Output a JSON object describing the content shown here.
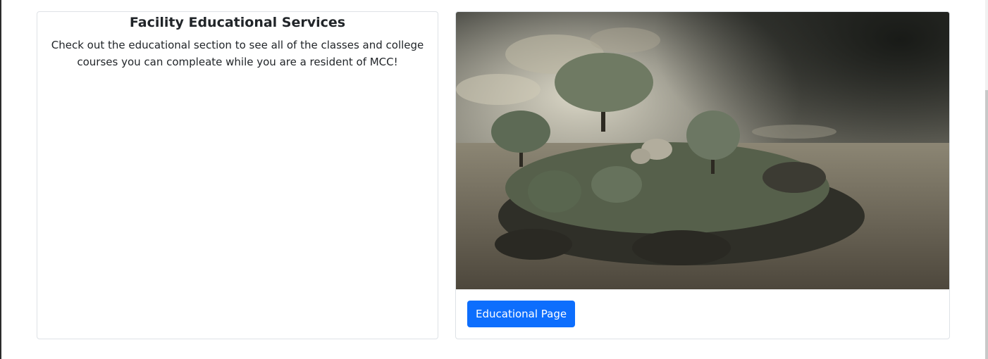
{
  "education_card": {
    "title": "Facility Educational Services",
    "text": "Check out the educational section to see all of the classes and college courses you can compleate while you are a resident of MCC!"
  },
  "image_card": {
    "image_icon": "turtle-island-landscape-image",
    "button_label": "Educational Page"
  },
  "colors": {
    "primary_button": "#0d6efd",
    "card_border": "#dee2e6",
    "text": "#212529"
  }
}
